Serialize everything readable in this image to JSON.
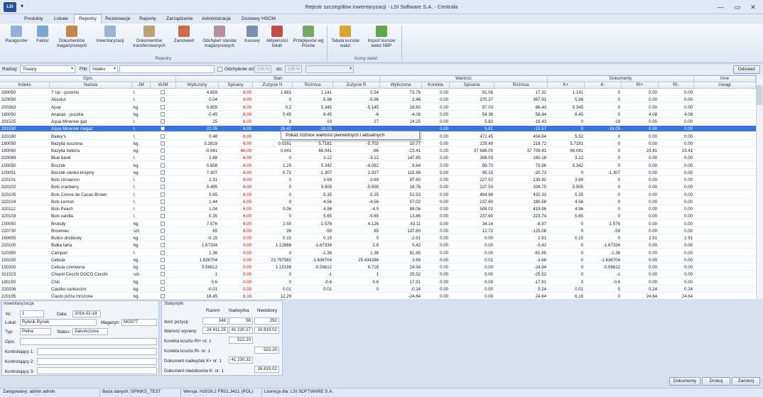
{
  "window": {
    "title": "Rejestr szczegółów inwentaryzacji - LSI Software S.A. - Centrala",
    "logo": "LSI",
    "quick_access": "▾",
    "minimize": "—",
    "maximize": "▭",
    "close": "✕"
  },
  "menu": [
    "Produkty",
    "Lokale",
    "Rejestry",
    "Rezerwacje",
    "Raporty",
    "Zarządzanie",
    "Administracja",
    "Dostawy HSCM"
  ],
  "menu_active": "Rejestry",
  "ribbon": {
    "group1": {
      "label": "Rejestry",
      "buttons": [
        "Paragonów",
        "Faktur",
        "Dokumentów magazynowych",
        "Inwentaryzacji",
        "Dokumentów transferowanych",
        "Zamówień",
        "Odchyleń stanów magazynowych",
        "Kasowy",
        "Aktywności lokali",
        "Przepływów wg Posów"
      ]
    },
    "group2": {
      "label": "Kursy walut",
      "buttons": [
        "Tabela kursów walut",
        "Import kursów walut NBP"
      ]
    }
  },
  "filter": {
    "rodzaj_label": "Rodzaj:",
    "rodzaj_value": "Towary",
    "filtr_label": "Filtr:",
    "filtr_value": "Indeks",
    "search_value": "",
    "odchylenie_label": "Odchylenie od:",
    "od_value": "100 %",
    "do_label": "do:",
    "do_value": "100 %",
    "extra_value": "",
    "refresh_button": "Odśwież"
  },
  "grid": {
    "groups": {
      "opis": "Opis",
      "stan": "Stan",
      "wartosc": "Wartość",
      "dokumenty": "Dokumenty",
      "inne": "Inne"
    },
    "columns": [
      "Indeks",
      "Nazwa",
      "JM",
      "WJM",
      "Wyliczony",
      "Spisany",
      "Zużycie N",
      "Różnica",
      "Zużycie R",
      "Wyliczona",
      "Korekta",
      "Spisana",
      "Różnica",
      "K+",
      "K-",
      "RI+",
      "RI-",
      "Uwagi"
    ],
    "rows": [
      [
        "290050",
        "7 Up - postmix",
        "l.",
        "",
        "4.859",
        "6.00",
        "1.681",
        "1.141",
        "0.54",
        "73.76",
        "0.00",
        "91.08",
        "17.32",
        "1.141",
        "0",
        "0.00",
        "0.00"
      ],
      [
        "320050",
        "Absolut",
        "l.",
        "",
        "0.04",
        "6.00",
        "0",
        "5.96",
        "-5.96",
        "2.46",
        "0.00",
        "370.37",
        "367.91",
        "5.96",
        "0",
        "0.00",
        "0.00"
      ],
      [
        "200363",
        "Ajvar",
        "kg.",
        "",
        "0.655",
        "6.00",
        "0.2",
        "5.345",
        "-5.145",
        "18.60",
        "0.00",
        "97.03",
        "86.43",
        "5.345",
        "0",
        "0.00",
        "0.00"
      ],
      [
        "160050",
        "Ananas - puszka",
        "kg.",
        "",
        "-0.45",
        "6.00",
        "0.45",
        "6.45",
        "-6",
        "-4.08",
        "0.00",
        "54.36",
        "58.44",
        "6.45",
        "0",
        "4.08",
        "4.08"
      ],
      [
        "291525",
        "Aqua Minerale gaz",
        "l.",
        "",
        "25",
        "6.00",
        "8",
        "-19",
        "27",
        "24.25",
        "0.00",
        "5.82",
        "-18.43",
        "0",
        "-19",
        "0.00",
        "0.00"
      ],
      [
        "291530",
        "Aqua Minerale niegaz",
        "l.",
        "",
        "22.05",
        "6.00",
        "28.42",
        "-16.05",
        "",
        "",
        "0.00",
        "5.81",
        "-15.57",
        "0",
        "-16.05",
        "0.00",
        "0.00"
      ],
      [
        "320180",
        "Bailey's",
        "l.",
        "",
        "0.48",
        "6.00",
        "",
        "",
        "",
        "",
        "0.00",
        "472.45",
        "434.64",
        "5.52",
        "0",
        "0.00",
        "0.00"
      ],
      [
        "180050",
        "Bazylia suszona",
        "kg.",
        "",
        "0.2819",
        "6.00",
        "0.0161",
        "5.7181",
        "-5.702",
        "10.77",
        "0.00",
        "229.49",
        "218.72",
        "5.7181",
        "0",
        "0.00",
        "0.00"
      ],
      [
        "180060",
        "Bazylia świeża",
        "kg.",
        "",
        "-0.041",
        "66.00",
        "0.041",
        "66.041",
        "-66",
        "-23.41",
        "0.00",
        "37 686.00",
        "37 709.41",
        "66.041",
        "0",
        "23.41",
        "23.41"
      ],
      [
        "320089",
        "Blue barel",
        "l.",
        "",
        "2.88",
        "6.00",
        "0",
        "3.12",
        "-3.12",
        "147.85",
        "0.00",
        "308.03",
        "160.18",
        "3.12",
        "0",
        "0.00",
        "0.00"
      ],
      [
        "100050",
        "Boczek",
        "kg.",
        "",
        "0.658",
        "6.00",
        "1.25",
        "5.342",
        "-4.092",
        "9.84",
        "0.00",
        "89.70",
        "79.86",
        "5.342",
        "0",
        "0.00",
        "0.00"
      ],
      [
        "100051",
        "Boczek cienko krojony",
        "kg.",
        "",
        "7.307",
        "6.00",
        "0.72",
        "-1.307",
        "2.027",
        "115.88",
        "0.00",
        "95.15",
        "-20.73",
        "0",
        "-1.307",
        "0.00",
        "0.00"
      ],
      [
        "320101",
        "Bols cinnamon",
        "l.",
        "",
        "2.31",
        "6.00",
        "0",
        "3.69",
        "-3.69",
        "87.60",
        "0.00",
        "227.52",
        "139.92",
        "3.69",
        "0",
        "0.00",
        "0.00"
      ],
      [
        "320102",
        "Bols cranberry",
        "l.",
        "",
        "0.495",
        "6.00",
        "0",
        "5.505",
        "-5.505",
        "18.78",
        "0.00",
        "227.53",
        "208.75",
        "5.505",
        "0",
        "0.00",
        "0.00"
      ],
      [
        "320105",
        "Bols Creme de Cacao Brown",
        "l.",
        "",
        "0.65",
        "6.00",
        "0",
        "5.35",
        "-5.35",
        "52.53",
        "0.00",
        "484.86",
        "432.33",
        "5.35",
        "0",
        "0.00",
        "0.00"
      ],
      [
        "320104",
        "Bols Lemon",
        "l.",
        "",
        "1.44",
        "6.00",
        "0",
        "4.56",
        "-4.56",
        "57.02",
        "0.00",
        "237.60",
        "180.58",
        "4.56",
        "0",
        "0.00",
        "0.00"
      ],
      [
        "320112",
        "Bols Peach",
        "l.",
        "",
        "1.04",
        "6.00",
        "0.06",
        "4.96",
        "-4.9",
        "88.06",
        "0.00",
        "508.02",
        "419.96",
        "4.96",
        "0",
        "0.00",
        "0.00"
      ],
      [
        "320103",
        "Bols vanilla",
        "l.",
        "",
        "0.35",
        "6.00",
        "0",
        "5.65",
        "-5.65",
        "13.86",
        "0.00",
        "237.60",
        "223.74",
        "5.65",
        "0",
        "0.00",
        "0.00"
      ],
      [
        "150050",
        "Brokuły",
        "kg.",
        "",
        "7.576",
        "6.00",
        "2.55",
        "-1.576",
        "4.126",
        "43.11",
        "0.00",
        "34.14",
        "-8.97",
        "0",
        "-1.576",
        "0.00",
        "0.00"
      ],
      [
        "220730",
        "Browniec",
        "szt.",
        "",
        "65",
        "6.00",
        "26",
        "-59",
        "85",
        "137.80",
        "0.00",
        "12.72",
        "-125.08",
        "0",
        "-59",
        "0.00",
        "0.00"
      ],
      [
        "160655",
        "Bulion drobiowy",
        "kg.",
        "",
        "-0.15",
        "0.00",
        "0.15",
        "0.15",
        "0",
        "-2.91",
        "0.00",
        "0.00",
        "2.91",
        "0.15",
        "0",
        "2.91",
        "2.91"
      ],
      [
        "220100",
        "Bułka tarta",
        "kg.",
        "",
        "1.67334",
        "0.00",
        "1.12666",
        "-1.67334",
        "2.8",
        "5.42",
        "0.00",
        "0.00",
        "-5.42",
        "0",
        "-1.67334",
        "0.00",
        "0.00"
      ],
      [
        "320350",
        "Campari",
        "l.",
        "",
        "1.36",
        "0.00",
        "0",
        "-1.36",
        "1.36",
        "81.85",
        "0.00",
        "0.00",
        "-81.85",
        "0",
        "-1.36",
        "0.00",
        "0.00"
      ],
      [
        "150150",
        "Cebula",
        "kg.",
        "",
        "1.636704",
        "0.00",
        "23.797582",
        "-1.636704",
        "25.434286",
        "3.69",
        "0.00",
        "0.01",
        "-3.68",
        "0",
        "-1.636704",
        "0.00",
        "0.00"
      ],
      [
        "150300",
        "Cebula czerwona",
        "kg.",
        "",
        "5.56612",
        "0.00",
        "1.15188",
        "-5.56612",
        "6.718",
        "24.94",
        "0.00",
        "0.00",
        "-24.94",
        "0",
        "-5.56612",
        "0.00",
        "0.00"
      ],
      [
        "321523",
        "Chianti Cecchi DOCG Cecchi",
        "szt.",
        "",
        "1",
        "0.00",
        "0",
        "-1",
        "1",
        "25.52",
        "0.00",
        "0.00",
        "-25.52",
        "0",
        "-1",
        "0.00",
        "0.00"
      ],
      [
        "180150",
        "Chili",
        "kg.",
        "",
        "0.6",
        "0.00",
        "0",
        "-0.6",
        "0.6",
        "17.91",
        "0.00",
        "0.00",
        "-17.91",
        "0",
        "-0.6",
        "0.00",
        "0.00"
      ],
      [
        "220206",
        "Ciastko cantuccini",
        "kg.",
        "",
        "-0.01",
        "0.00",
        "0.01",
        "0.01",
        "0",
        "-0.24",
        "0.00",
        "0.00",
        "0.24",
        "0.01",
        "0",
        "0.24",
        "0.24"
      ],
      [
        "220195",
        "Ciasto pizza mrożone",
        "kg.",
        "",
        "18.45",
        "6.16",
        "12.29",
        "",
        "",
        "-24.64",
        "0.00",
        "0.00",
        "24.64",
        "6.16",
        "0",
        "24.64",
        "24.64"
      ]
    ]
  },
  "context_menu": "Pokaż różnice wartości pierwotnych i aktualnych",
  "inventory": {
    "title": "Inwentaryzacja",
    "nr_label": "Nr:",
    "nr": "1",
    "data_label": "Data:",
    "data": "2016-02-18",
    "lokal_label": "Lokal:",
    "lokal": "Rybnik Rynek",
    "magazyn_label": "Magazyn:",
    "magazyn": "MG077",
    "typ_label": "Typ:",
    "typ": "Pełna",
    "status_label": "Status:",
    "status": "Zakończona",
    "opis_label": "Opis:",
    "opis": "",
    "k1_label": "Kontrolujący 1:",
    "k2_label": "Kontrolujący 2:",
    "k3_label": "Kontrolujący 3:"
  },
  "stats": {
    "title": "Statystyki",
    "col_razem": "Razem",
    "col_nadwyzka": "Nadwyżka",
    "col_niedobory": "Niedobory",
    "ilosc_label": "Ilość pozycji:",
    "ilosc": [
      "348",
      "56",
      "292"
    ],
    "wartosc_label": "Wartość wyceny:",
    "wartosc": [
      "24 411.25",
      "41 230.27",
      "16 819.02"
    ],
    "kor_plus_label": "Korekta kosztu RI+ nr: 1",
    "kor_plus": "522.20",
    "kor_minus_label": "Korekta kosztu RI- nr: 1",
    "kor_minus": "522.20",
    "dok_plus_label": "Dokument nadwyżek K+ nr: 1",
    "dok_plus": "41 230.32",
    "dok_minus_label": "Dokument niedoborów K- nr: 1",
    "dok_minus": "16 819.02"
  },
  "buttons": {
    "dokumenty": "Dokumenty",
    "drukuj": "Drukuj",
    "zamknij": "Zamknij"
  },
  "statusbar": {
    "user": "Zalogowany: admin admin",
    "db": "Baza danych: SPINKS_TEST",
    "version": "Wersja: H2016.2 FR01.3421 (POL)",
    "license": "Licencja dla: LSI SOFTWARE S.A."
  }
}
